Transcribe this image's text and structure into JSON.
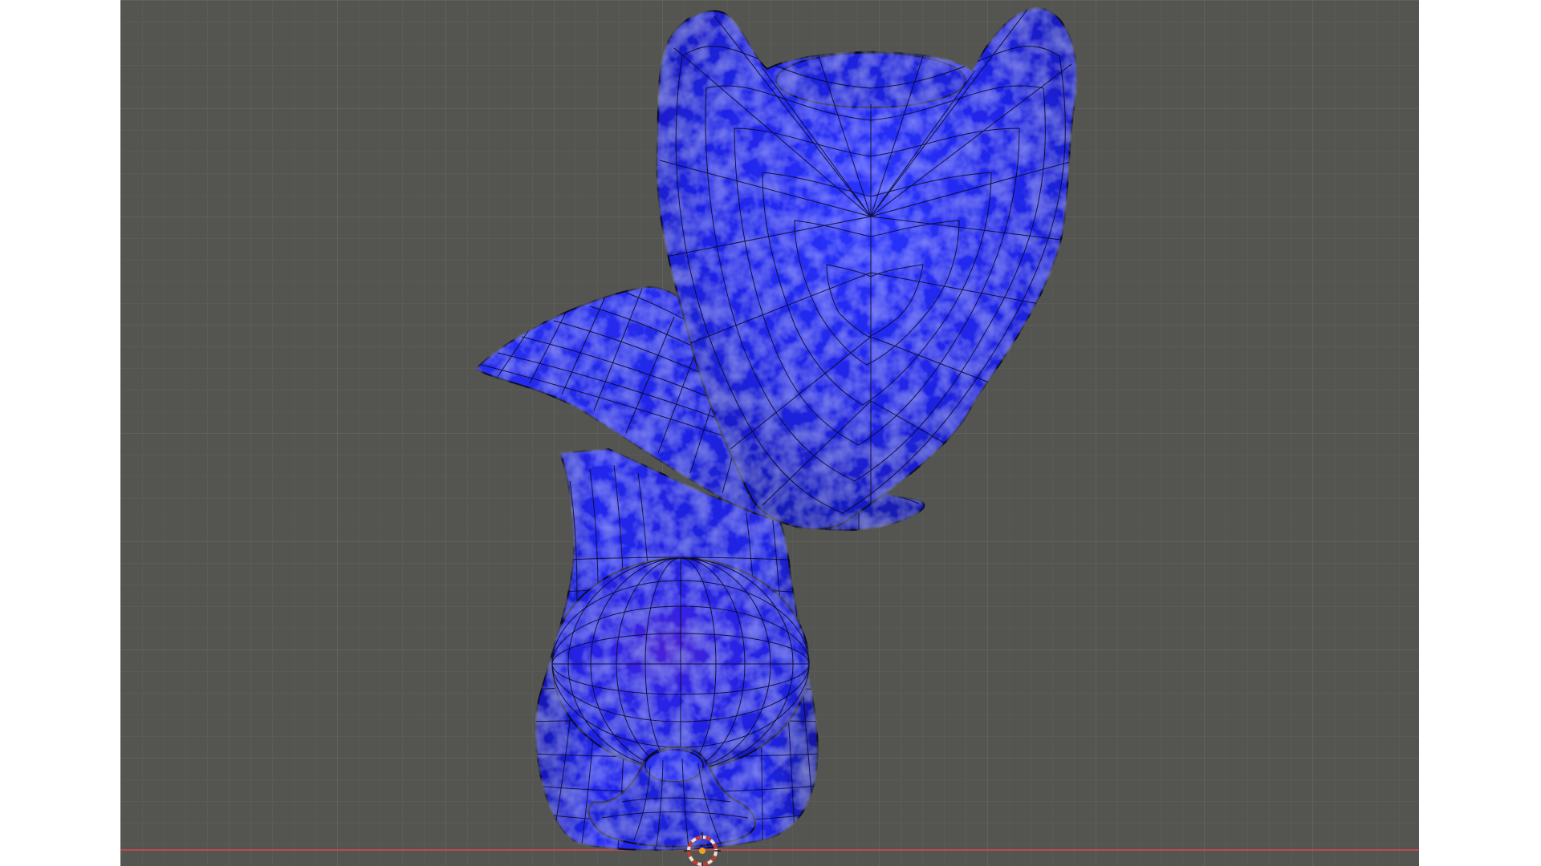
{
  "viewport": {
    "background_color": "#545550",
    "grid_color": "#5f605b",
    "grid_major_color": "#666761",
    "x_axis_color": "#b84b4f"
  },
  "mesh": {
    "material_color": "#1f23e8",
    "shadow_color": "#0f12a8",
    "highlight_color": "#5a62ff",
    "wireframe_color": "#0a0a28",
    "interior_tint_color": "#6d20a8"
  },
  "cursor": {
    "icon": "3d-cursor-icon",
    "ring_color": "#e8e2d8",
    "dash_color": "#c23b2c",
    "center_color": "#f0a21a"
  }
}
